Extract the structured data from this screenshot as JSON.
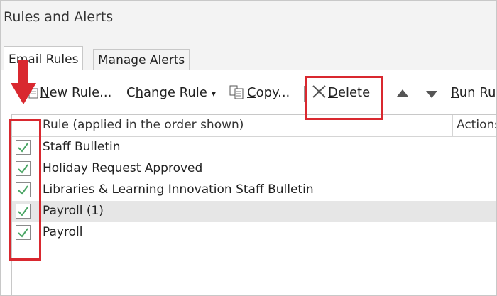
{
  "window": {
    "title": "Rules and Alerts"
  },
  "tabs": [
    {
      "label": "Email Rules",
      "active": true
    },
    {
      "label": "Manage Alerts",
      "active": false
    }
  ],
  "toolbar": {
    "new_rule": {
      "mnemonic": "N",
      "rest": "ew Rule..."
    },
    "change_rule": {
      "prefix": "C",
      "mnemonic": "h",
      "rest": "ange Rule",
      "caret": "▾"
    },
    "copy": {
      "mnemonic": "C",
      "rest": "opy..."
    },
    "delete": {
      "mnemonic": "D",
      "rest": "elete"
    },
    "run_rules": {
      "mnemonic": "R",
      "rest": "un Ru"
    }
  },
  "grid": {
    "columns": [
      "Rule (applied in the order shown)",
      "Actions"
    ],
    "rows": [
      {
        "name": "Staff Bulletin",
        "checked": true,
        "selected": false
      },
      {
        "name": "Holiday Request Approved",
        "checked": true,
        "selected": false
      },
      {
        "name": "Libraries & Learning Innovation Staff Bulletin",
        "checked": true,
        "selected": false
      },
      {
        "name": "Payroll (1)",
        "checked": true,
        "selected": true
      },
      {
        "name": "Payroll",
        "checked": true,
        "selected": false
      }
    ]
  },
  "colors": {
    "annotation_red": "#d9282f",
    "check_green": "#4aa564",
    "selection_gray": "#e6e6e6"
  }
}
